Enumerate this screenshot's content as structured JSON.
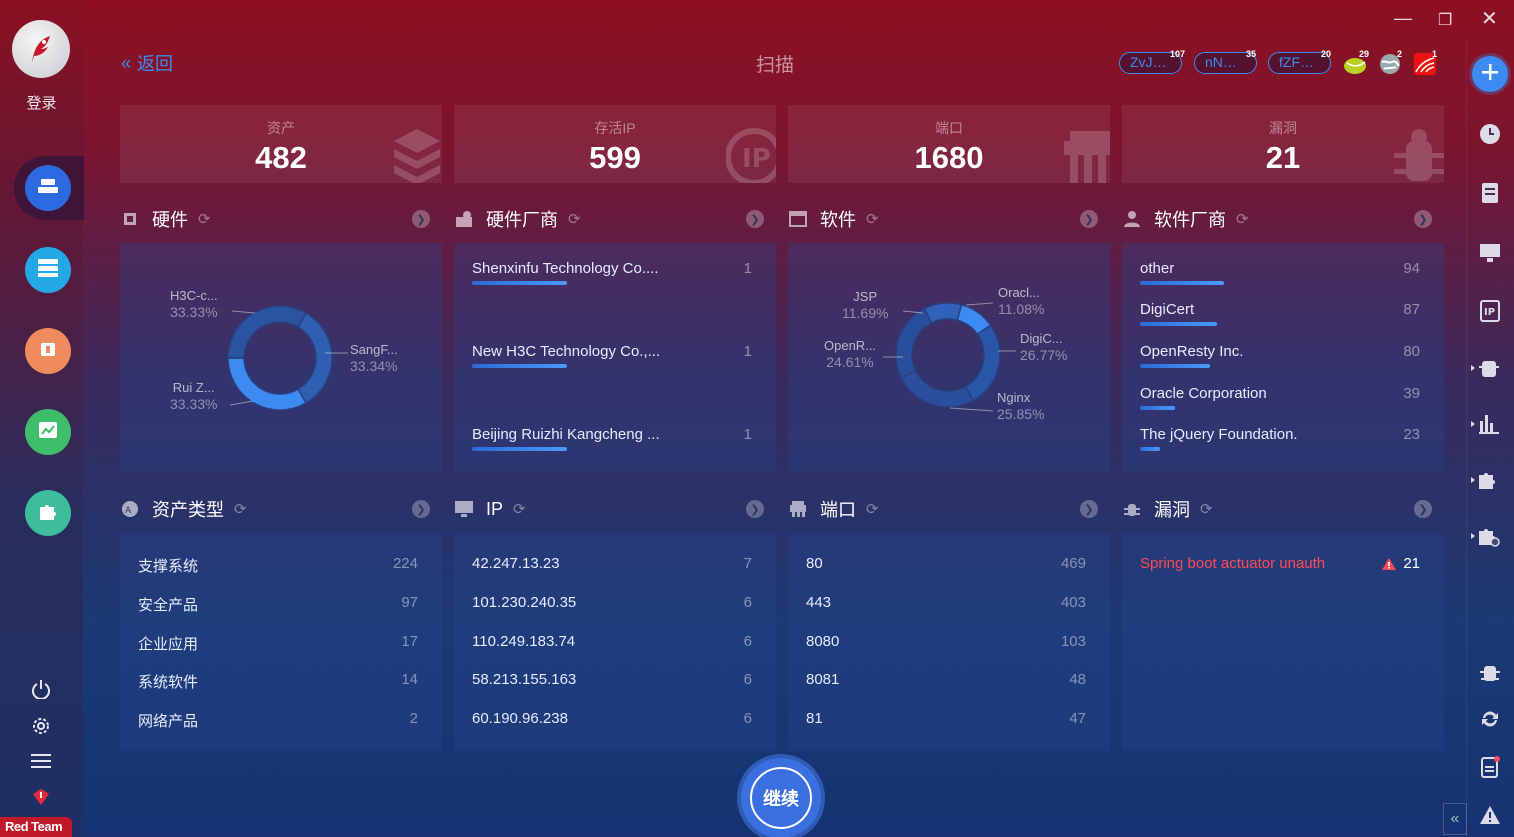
{
  "app": {
    "login_label": "登录",
    "badge": "Red Team",
    "title": "扫描",
    "back_label": "返回"
  },
  "tags": [
    {
      "label": "ZvJ…",
      "count": "107"
    },
    {
      "label": "nN…",
      "count": "35"
    },
    {
      "label": "fZF…",
      "count": "20"
    }
  ],
  "tag_icons": [
    {
      "icon": "tennis-ball-icon",
      "count": "29"
    },
    {
      "icon": "globe-icon",
      "count": "2"
    },
    {
      "icon": "wave-logo-icon",
      "count": "1"
    }
  ],
  "stats": [
    {
      "label": "资产",
      "value": "482",
      "icon": "layers-icon"
    },
    {
      "label": "存活IP",
      "value": "599",
      "icon": "ip-icon"
    },
    {
      "label": "端口",
      "value": "1680",
      "icon": "port-icon"
    },
    {
      "label": "漏洞",
      "value": "21",
      "icon": "bug-icon"
    }
  ],
  "sections": {
    "hardware": "硬件",
    "hw_vendor": "硬件厂商",
    "software": "软件",
    "sw_vendor": "软件厂商",
    "asset_type": "资产类型",
    "ip": "IP",
    "port": "端口",
    "vuln": "漏洞"
  },
  "hardware_chart": {
    "type": "pie",
    "slices": [
      {
        "label": "H3C-c...",
        "pct": "33.33%",
        "value": 33.33,
        "color": "#2f5fb0"
      },
      {
        "label": "SangF...",
        "pct": "33.34%",
        "value": 33.34,
        "color": "#3d8bf0"
      },
      {
        "label": "Rui Z...",
        "pct": "33.33%",
        "value": 33.33,
        "color": "#2a54a0"
      }
    ]
  },
  "software_chart": {
    "type": "pie",
    "slices": [
      {
        "label": "Oracl...",
        "pct": "11.08%",
        "value": 11.08,
        "color": "#3d8bf0"
      },
      {
        "label": "DigiC...",
        "pct": "26.77%",
        "value": 26.77,
        "color": "#2a56a8"
      },
      {
        "label": "Nginx",
        "pct": "25.85%",
        "value": 25.85,
        "color": "#2b4f9c"
      },
      {
        "label": "OpenR...",
        "pct": "24.61%",
        "value": 24.61,
        "color": "#2a4e9a"
      },
      {
        "label": "JSP",
        "pct": "11.69%",
        "value": 11.69,
        "color": "#2f62b8"
      }
    ]
  },
  "hw_vendors": [
    {
      "name": "Shenxinfu Technology Co....",
      "count": "1"
    },
    {
      "name": "New H3C Technology Co.,...",
      "count": "1"
    },
    {
      "name": "Beijing Ruizhi Kangcheng ...",
      "count": "1"
    }
  ],
  "sw_vendors": [
    {
      "name": "other",
      "count": "94"
    },
    {
      "name": "DigiCert",
      "count": "87"
    },
    {
      "name": "OpenResty Inc.",
      "count": "80"
    },
    {
      "name": "Oracle Corporation",
      "count": "39"
    },
    {
      "name": "The jQuery Foundation.",
      "count": "23"
    }
  ],
  "asset_types": [
    {
      "name": "支撑系统",
      "count": "224"
    },
    {
      "name": "安全产品",
      "count": "97"
    },
    {
      "name": "企业应用",
      "count": "17"
    },
    {
      "name": "系统软件",
      "count": "14"
    },
    {
      "name": "网络产品",
      "count": "2"
    }
  ],
  "ips": [
    {
      "name": "42.247.13.23",
      "count": "7"
    },
    {
      "name": "101.230.240.35",
      "count": "6"
    },
    {
      "name": "110.249.183.74",
      "count": "6"
    },
    {
      "name": "58.213.155.163",
      "count": "6"
    },
    {
      "name": "60.190.96.238",
      "count": "6"
    }
  ],
  "ports": [
    {
      "name": "80",
      "count": "469"
    },
    {
      "name": "443",
      "count": "403"
    },
    {
      "name": "8080",
      "count": "103"
    },
    {
      "name": "8081",
      "count": "48"
    },
    {
      "name": "81",
      "count": "47"
    }
  ],
  "vulns": [
    {
      "name": "Spring boot actuator unauth",
      "count": "21"
    }
  ],
  "continue_label": "继续",
  "colors": {
    "accent": "#3d8bf0",
    "danger": "#ff4a55"
  }
}
